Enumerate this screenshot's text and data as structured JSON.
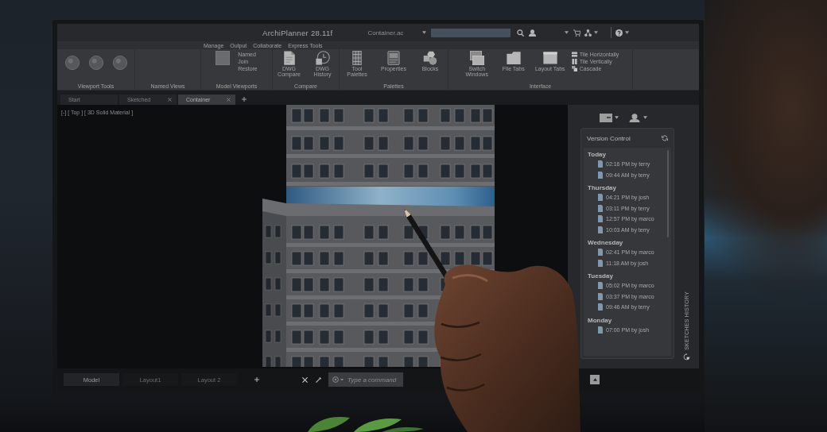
{
  "window": {
    "title": "ArchiPlanner 28.11f",
    "file_name": "Container.ac"
  },
  "menu": [
    "Manage",
    "Output",
    "Collaborate",
    "Express Tools"
  ],
  "ribbon": [
    {
      "label": "Viewport Tools",
      "tools": [
        {
          "kind": "large"
        },
        {
          "kind": "large"
        },
        {
          "kind": "large"
        }
      ]
    },
    {
      "label": "Named Views"
    },
    {
      "label": "Model Viewports",
      "tools": [
        {
          "kind": "large"
        },
        {
          "kind": "list",
          "items": [
            "Named",
            "Join",
            "Restore"
          ]
        }
      ]
    },
    {
      "label": "Compare",
      "tools": [
        {
          "kind": "large",
          "label": "DWG Compare"
        },
        {
          "kind": "large",
          "label": "DWG History"
        }
      ]
    },
    {
      "label": "Palettes",
      "tools": [
        {
          "kind": "large",
          "label": "Tool Palettes"
        },
        {
          "kind": "large",
          "label": "Properties"
        },
        {
          "kind": "large",
          "label": "Blocks"
        }
      ]
    },
    {
      "label": "Interface",
      "tools": [
        {
          "kind": "large",
          "label": "Switch Windows"
        },
        {
          "kind": "large",
          "label": "File Tabs"
        },
        {
          "kind": "large",
          "label": "Layout Tabs"
        },
        {
          "kind": "icon_list",
          "items": [
            "Tile Horizontally",
            "Tile Vertically",
            "Cascade"
          ]
        }
      ]
    }
  ],
  "doc_tabs": [
    {
      "label": "Start",
      "selected": false,
      "closable": false
    },
    {
      "label": "Sketched",
      "selected": false,
      "closable": true
    },
    {
      "label": "Container",
      "selected": true,
      "closable": true
    }
  ],
  "viewport": {
    "label": "[-] [ Top ] [ 3D Solid Material ]"
  },
  "version_control": {
    "title": "Version Control",
    "days": [
      {
        "label": "Today",
        "entries": [
          "02:16 PM by terry",
          "09:44 AM by terry"
        ]
      },
      {
        "label": "Thursday",
        "entries": [
          "04:21 PM by josh",
          "03:11 PM by terry",
          "12:57 PM by marco",
          "10:03 AM by terry"
        ]
      },
      {
        "label": "Wednesday",
        "entries": [
          "02:41 PM by marco",
          "11:18 AM by josh"
        ]
      },
      {
        "label": "Tuesday",
        "entries": [
          "05:02 PM by marco",
          "03:37 PM by marco",
          "09:46 AM by terry"
        ]
      },
      {
        "label": "Monday",
        "entries": [
          "07:00 PM by josh"
        ]
      }
    ]
  },
  "side_tab": {
    "label": "SKETCHES HISTORY"
  },
  "layout_tabs": [
    {
      "label": "Model",
      "selected": true
    },
    {
      "label": "Layout1",
      "selected": false
    },
    {
      "label": "Layout 2",
      "selected": false
    }
  ],
  "command_line": {
    "placeholder": "Type a command"
  }
}
